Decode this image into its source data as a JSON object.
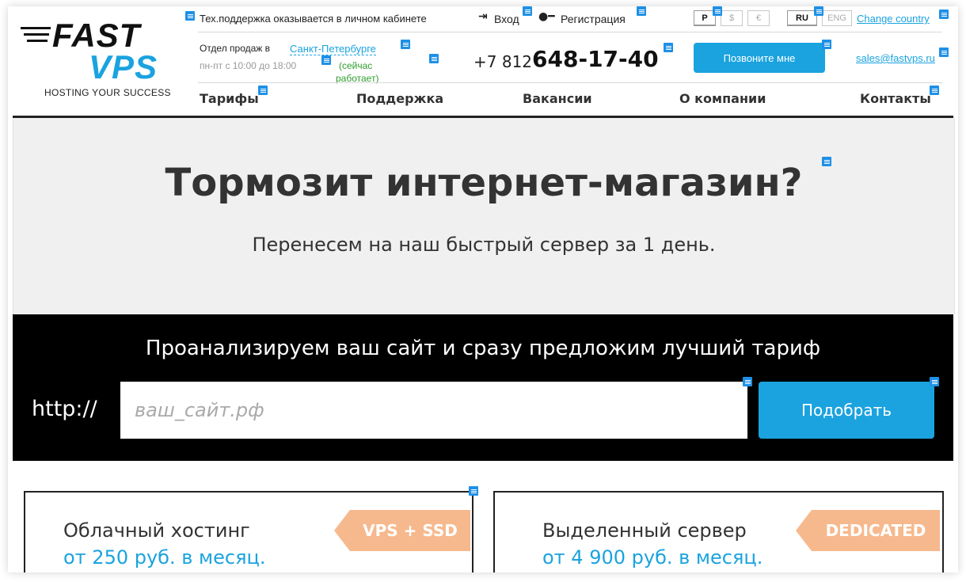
{
  "logo": {
    "word1": "FAST",
    "word2": "VPS",
    "tagline": "HOSTING YOUR SUCCESS"
  },
  "header": {
    "support_note": "Тех.поддержка оказывается в личном кабинете",
    "login": "Вход",
    "register": "Регистрация",
    "currencies": [
      "Р",
      "$",
      "€"
    ],
    "languages": [
      "RU",
      "ENG"
    ],
    "change_country": "Change country",
    "sales_prefix": "Отдел продаж в",
    "city": "Санкт-Петербурге",
    "hours": "пн-пт  с 10:00 до 18:00",
    "status_line1": "(сейчас",
    "status_line2": "работает)",
    "phone_prefix": "+7 812",
    "phone_number": "648-17-40",
    "call_button": "Позвоните мне",
    "email": "sales@fastvps.ru"
  },
  "nav": [
    "Тарифы",
    "Поддержка",
    "Вакансии",
    "О компании",
    "Контакты"
  ],
  "hero": {
    "title": "Тормозит интернет-магазин?",
    "subtitle": "Перенесем на наш быстрый сервер за 1 день."
  },
  "analyze": {
    "heading": "Проанализируем ваш сайт и сразу предложим лучший тариф",
    "prefix": "http://",
    "placeholder": "ваш_сайт.рф",
    "button": "Подобрать"
  },
  "cards": [
    {
      "title": "Облачный хостинг",
      "price": "от 250 руб. в месяц.",
      "badge": "VPS + SSD"
    },
    {
      "title": "Выделенный сервер",
      "price": "от 4 900 руб. в месяц.",
      "badge": "DEDICATED"
    }
  ],
  "colors": {
    "accent": "#1aa3df",
    "badge": "#f6b98d",
    "marker": "#1e90e6"
  }
}
